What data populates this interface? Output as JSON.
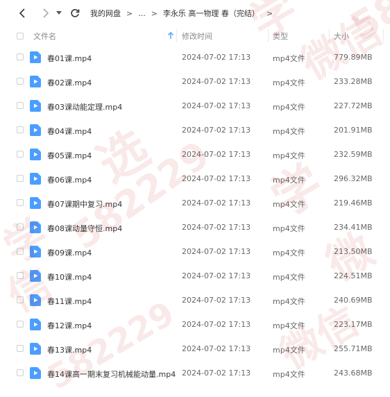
{
  "toolbar": {
    "back_icon": "chevron-left-icon",
    "forward_icon": "chevron-right-icon",
    "history_icon": "caret-down-icon",
    "refresh_icon": "refresh-icon"
  },
  "breadcrumb": {
    "root": "我的网盘",
    "sep1": ">",
    "ellipsis": "...",
    "sep2": ">",
    "current": "李永乐 高一物理 春（完结）",
    "sep3": ">"
  },
  "columns": {
    "name": "文件名",
    "modified": "修改时间",
    "type": "类型",
    "size": "大小",
    "sort_icon": "sort-up-icon"
  },
  "files": [
    {
      "name": "春01课.mp4",
      "modified": "2024-07-02 17:13",
      "type": "mp4文件",
      "size": "779.89MB"
    },
    {
      "name": "春02课.mp4",
      "modified": "2024-07-02 17:13",
      "type": "mp4文件",
      "size": "233.28MB"
    },
    {
      "name": "春03课动能定理.mp4",
      "modified": "2024-07-02 17:13",
      "type": "mp4文件",
      "size": "227.72MB"
    },
    {
      "name": "春04课.mp4",
      "modified": "2024-07-02 17:13",
      "type": "mp4文件",
      "size": "201.91MB"
    },
    {
      "name": "春05课.mp4",
      "modified": "2024-07-02 17:13",
      "type": "mp4文件",
      "size": "232.59MB"
    },
    {
      "name": "春06课.mp4",
      "modified": "2024-07-02 17:13",
      "type": "mp4文件",
      "size": "296.32MB"
    },
    {
      "name": "春07课期中复习.mp4",
      "modified": "2024-07-02 17:13",
      "type": "mp4文件",
      "size": "219.46MB"
    },
    {
      "name": "春08课动量守恒.mp4",
      "modified": "2024-07-02 17:13",
      "type": "mp4文件",
      "size": "234.41MB"
    },
    {
      "name": "春09课.mp4",
      "modified": "2024-07-02 17:13",
      "type": "mp4文件",
      "size": "213.50MB"
    },
    {
      "name": "春10课.mp4",
      "modified": "2024-07-02 17:13",
      "type": "mp4文件",
      "size": "224.51MB"
    },
    {
      "name": "春11课.mp4",
      "modified": "2024-07-02 17:13",
      "type": "mp4文件",
      "size": "240.69MB"
    },
    {
      "name": "春12课.mp4",
      "modified": "2024-07-02 17:13",
      "type": "mp4文件",
      "size": "223.17MB"
    },
    {
      "name": "春13课.mp4",
      "modified": "2024-07-02 17:13",
      "type": "mp4文件",
      "size": "255.71MB"
    },
    {
      "name": "春14课高一期末复习机械能动量.mp4",
      "modified": "2024-07-02 17:13",
      "type": "mp4文件",
      "size": "243.68MB"
    }
  ],
  "colors": {
    "video_icon": "#4a9eff",
    "watermark": "#c82828"
  },
  "watermark_text": [
    "学",
    "微信",
    "58",
    "选",
    "582229",
    "学",
    "微",
    "信",
    "学",
    "微信",
    "582229"
  ]
}
